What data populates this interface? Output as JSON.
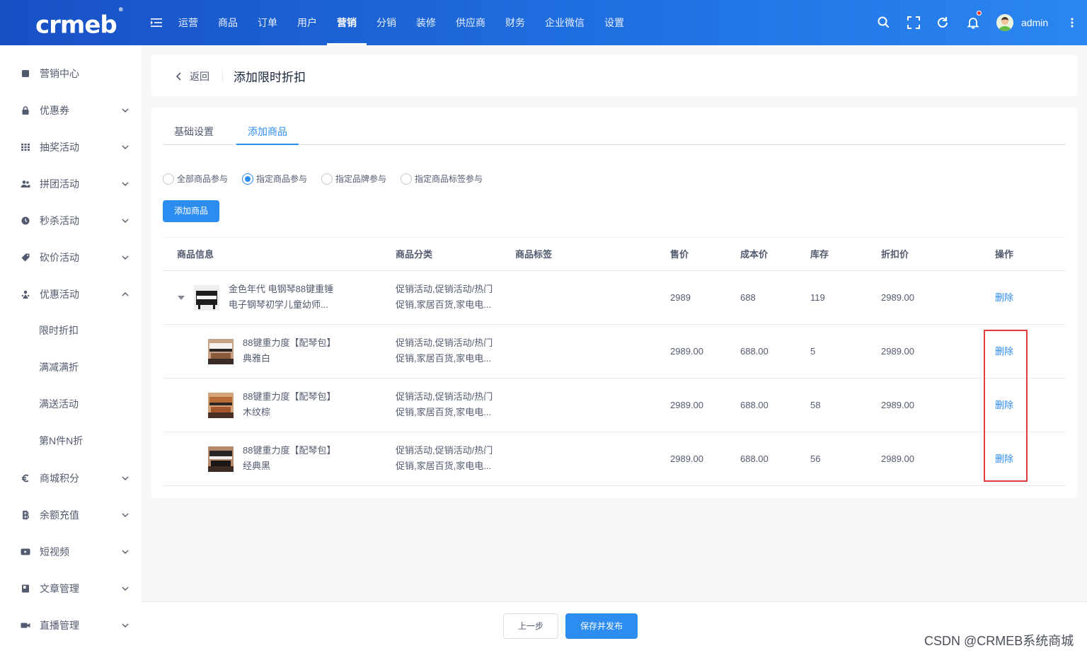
{
  "header": {
    "logo": "crmeb",
    "logo_mark": "®",
    "nav": [
      "运营",
      "商品",
      "订单",
      "用户",
      "营销",
      "分销",
      "装修",
      "供应商",
      "财务",
      "企业微信",
      "设置"
    ],
    "active_nav_index": 4,
    "username": "admin",
    "accent": "#2d8cf0"
  },
  "sidebar": {
    "items": [
      {
        "label": "营销中心",
        "icon": "marketing-icon",
        "arrow": ""
      },
      {
        "label": "优惠券",
        "icon": "lock-icon",
        "arrow": "down"
      },
      {
        "label": "抽奖活动",
        "icon": "grid-icon",
        "arrow": "down"
      },
      {
        "label": "拼团活动",
        "icon": "group-icon",
        "arrow": "down"
      },
      {
        "label": "秒杀活动",
        "icon": "clock-icon",
        "arrow": "down"
      },
      {
        "label": "砍价活动",
        "icon": "tag-icon",
        "arrow": "down"
      },
      {
        "label": "优惠活动",
        "icon": "discount-icon",
        "arrow": "up"
      },
      {
        "label": "限时折扣",
        "icon": "",
        "arrow": ""
      },
      {
        "label": "满减满折",
        "icon": "",
        "arrow": ""
      },
      {
        "label": "满送活动",
        "icon": "",
        "arrow": ""
      },
      {
        "label": "第N件N折",
        "icon": "",
        "arrow": ""
      },
      {
        "label": "商城积分",
        "icon": "euro-icon",
        "arrow": "down"
      },
      {
        "label": "余额充值",
        "icon": "bitcoin-icon",
        "arrow": "down"
      },
      {
        "label": "短视频",
        "icon": "video-icon",
        "arrow": "down"
      },
      {
        "label": "文章管理",
        "icon": "book-icon",
        "arrow": "down"
      },
      {
        "label": "直播管理",
        "icon": "camera-icon",
        "arrow": "down"
      }
    ]
  },
  "page": {
    "back_label": "返回",
    "title": "添加限时折扣",
    "tabs": [
      "基础设置",
      "添加商品"
    ],
    "active_tab_index": 1,
    "radios": [
      "全部商品参与",
      "指定商品参与",
      "指定品牌参与",
      "指定商品标签参与"
    ],
    "checked_radio_index": 1,
    "add_button": "添加商品"
  },
  "table": {
    "headers": [
      "商品信息",
      "商品分类",
      "商品标签",
      "售价",
      "成本价",
      "库存",
      "折扣价",
      "操作"
    ],
    "rows": [
      {
        "name1": "金色年代 电钢琴88键重锤",
        "name2": "电子钢琴初学儿童幼师...",
        "cat1": "促销活动,促销活动/热门",
        "cat2": "促销,家居百货,家电电...",
        "tag": "",
        "price": "2989",
        "cost": "688",
        "stock": "119",
        "discount": "2989.00",
        "action": "删除",
        "thumb": "piano-black"
      },
      {
        "name1": "88键重力度【配琴包】",
        "name2": "典雅白",
        "cat1": "促销活动,促销活动/热门",
        "cat2": "促销,家居百货,家电电...",
        "tag": "",
        "price": "2989.00",
        "cost": "688.00",
        "stock": "5",
        "discount": "2989.00",
        "action": "删除",
        "thumb": "piano-white"
      },
      {
        "name1": "88键重力度【配琴包】",
        "name2": "木纹棕",
        "cat1": "促销活动,促销活动/热门",
        "cat2": "促销,家居百货,家电电...",
        "tag": "",
        "price": "2989.00",
        "cost": "688.00",
        "stock": "58",
        "discount": "2989.00",
        "action": "删除",
        "thumb": "piano-wood"
      },
      {
        "name1": "88键重力度【配琴包】",
        "name2": "经典黑",
        "cat1": "促销活动,促销活动/热门",
        "cat2": "促销,家居百货,家电电...",
        "tag": "",
        "price": "2989.00",
        "cost": "688.00",
        "stock": "56",
        "discount": "2989.00",
        "action": "删除",
        "thumb": "piano-dark"
      }
    ]
  },
  "footer": {
    "prev_label": "上一步",
    "save_label": "保存并发布"
  },
  "watermark": "CSDN @CRMEB系统商城"
}
